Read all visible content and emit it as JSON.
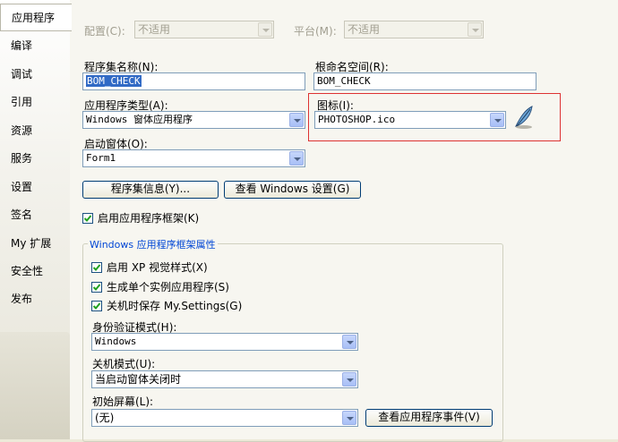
{
  "tabs": [
    "应用程序",
    "编译",
    "调试",
    "引用",
    "资源",
    "服务",
    "设置",
    "签名",
    "My 扩展",
    "安全性",
    "发布"
  ],
  "topbar": {
    "config_label": "配置(C):",
    "config_value": "不适用",
    "platform_label": "平台(M):",
    "platform_value": "不适用"
  },
  "assembly_name": {
    "label": "程序集名称(N):",
    "value": "BOM_CHECK"
  },
  "root_namespace": {
    "label": "根命名空间(R):",
    "value": "BOM_CHECK"
  },
  "app_type": {
    "label": "应用程序类型(A):",
    "value": "Windows 窗体应用程序"
  },
  "icon": {
    "label": "图标(I):",
    "value": "PHOTOSHOP.ico"
  },
  "startup_form": {
    "label": "启动窗体(O):",
    "value": "Form1"
  },
  "buttons": {
    "assembly_info": "程序集信息(Y)...",
    "view_windows_settings": "查看 Windows 设置(G)"
  },
  "enable_framework": {
    "label": "启用应用程序框架(K)",
    "checked": true
  },
  "framework_group": {
    "title": "Windows 应用程序框架属性",
    "xp_styles": {
      "label": "启用 XP 视觉样式(X)",
      "checked": true
    },
    "single_instance": {
      "label": "生成单个实例应用程序(S)",
      "checked": true
    },
    "save_settings": {
      "label": "关机时保存 My.Settings(G)",
      "checked": true
    },
    "auth_mode": {
      "label": "身份验证模式(H):",
      "value": "Windows"
    },
    "shutdown_mode": {
      "label": "关机模式(U):",
      "value": "当启动窗体关闭时"
    },
    "splash_screen": {
      "label": "初始屏幕(L):",
      "value": "(无)"
    },
    "view_events_button": "查看应用程序事件(V)"
  },
  "colors": {
    "highlight_box": "#dd3333",
    "selection": "#316ac5",
    "group_title": "#0046d5"
  }
}
